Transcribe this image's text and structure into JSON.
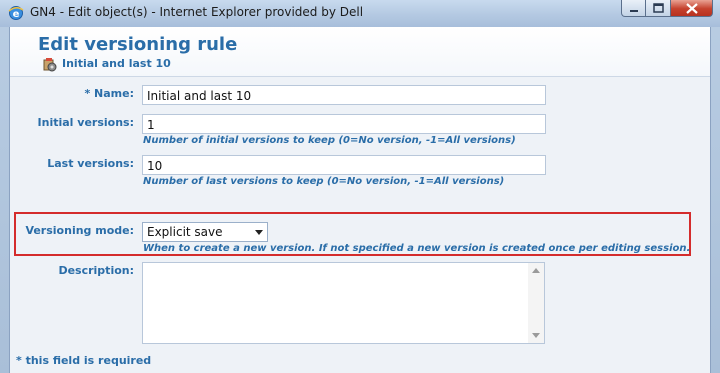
{
  "window": {
    "title": "GN4 - Edit object(s) - Internet Explorer provided by Dell",
    "controls": {
      "minimize": "minimize",
      "maximize": "maximize",
      "close": "close"
    }
  },
  "header": {
    "title": "Edit versioning rule",
    "object_name": "Initial and last 10"
  },
  "form": {
    "name": {
      "label": "*  Name:",
      "value": "Initial and last 10"
    },
    "initial_versions": {
      "label": "Initial versions:",
      "value": "1",
      "hint": "Number of initial versions to keep (0=No version, -1=All versions)"
    },
    "last_versions": {
      "label": "Last versions:",
      "value": "10",
      "hint": "Number of last versions to keep (0=No version, -1=All versions)"
    },
    "versioning_mode": {
      "label": "Versioning mode:",
      "selected": "Explicit save",
      "hint": "When to create a new version. If not specified a new version is created once per editing session."
    },
    "description": {
      "label": "Description:",
      "value": ""
    },
    "required_note": "* this field is required"
  },
  "colors": {
    "accent": "#2a6da8",
    "highlight_border": "#d42c2c",
    "form_background": "#eef2f7"
  }
}
